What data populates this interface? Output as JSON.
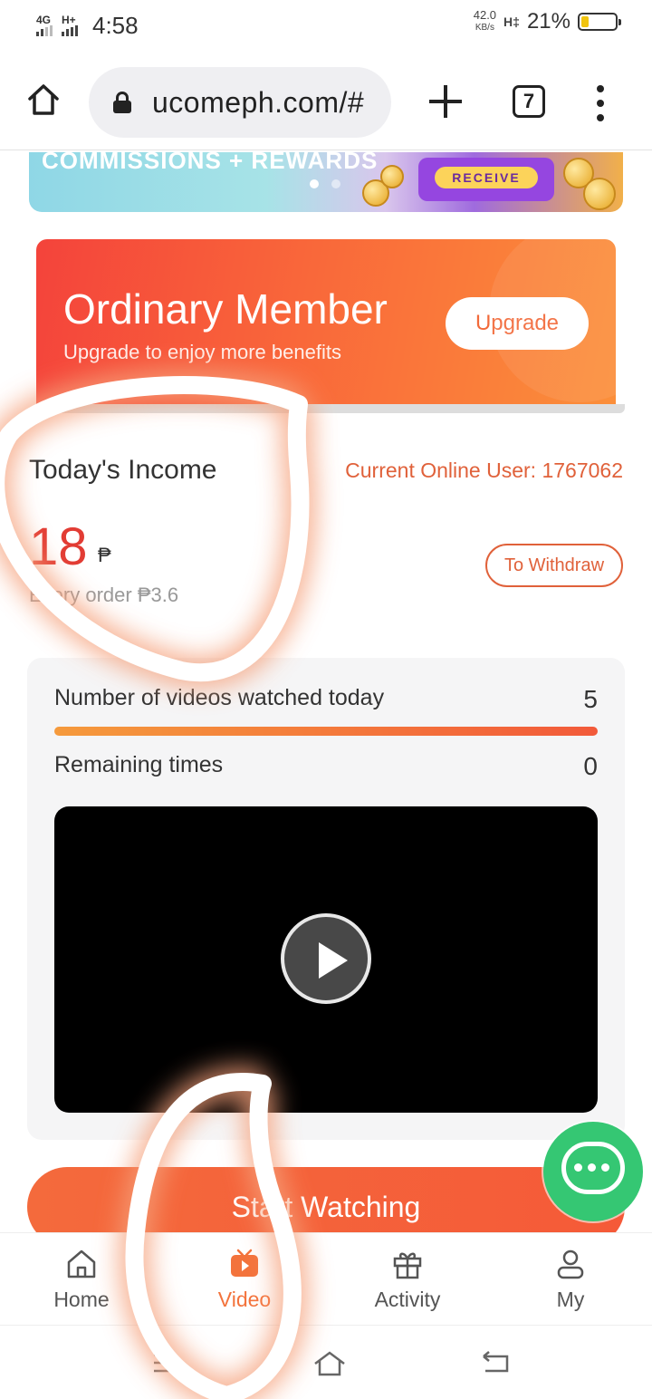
{
  "status_bar": {
    "network_1": "4G",
    "network_2": "H+",
    "time": "4:58",
    "speed_value": "42.0",
    "speed_unit": "KB/s",
    "network_3": "H‡",
    "battery": "21%",
    "battery_level": 0.21,
    "battery_color": "#f1c40f"
  },
  "browser": {
    "url": "ucomeph.com/#",
    "tab_count": "7",
    "icons": [
      "home-icon",
      "lock-icon",
      "plus-icon",
      "tabs-icon",
      "menu-icon"
    ]
  },
  "banner": {
    "text": "COMMISSIONS + REWARDS",
    "button": "RECEIVE",
    "active_dot": 0,
    "dot_count": 2
  },
  "member_card": {
    "title": "Ordinary Member",
    "subtitle": "Upgrade to enjoy more benefits",
    "upgrade_label": "Upgrade"
  },
  "income": {
    "label": "Today's Income",
    "online_user": "Current Online User: 1767062",
    "value": "18",
    "currency": "₱",
    "per_order": "Every order ₱3.6",
    "withdraw_label": "To Withdraw"
  },
  "stats": {
    "watched_label": "Number of videos watched today",
    "watched_value": "5",
    "progress": 1.0,
    "remaining_label": "Remaining times",
    "remaining_value": "0"
  },
  "video": {
    "play_icon": "play-icon"
  },
  "start_button": "Start Watching",
  "tabs": [
    {
      "label": "Home",
      "icon": "home-icon",
      "active": false
    },
    {
      "label": "Video",
      "icon": "video-icon",
      "active": true
    },
    {
      "label": "Activity",
      "icon": "gift-icon",
      "active": false
    },
    {
      "label": "My",
      "icon": "user-icon",
      "active": false
    }
  ],
  "colors": {
    "accent": "#f3733c",
    "member_gradient_start": "#f4433b",
    "member_gradient_end": "#fb8f3a",
    "income_red": "#e23c34",
    "chat_green": "#35c773"
  }
}
